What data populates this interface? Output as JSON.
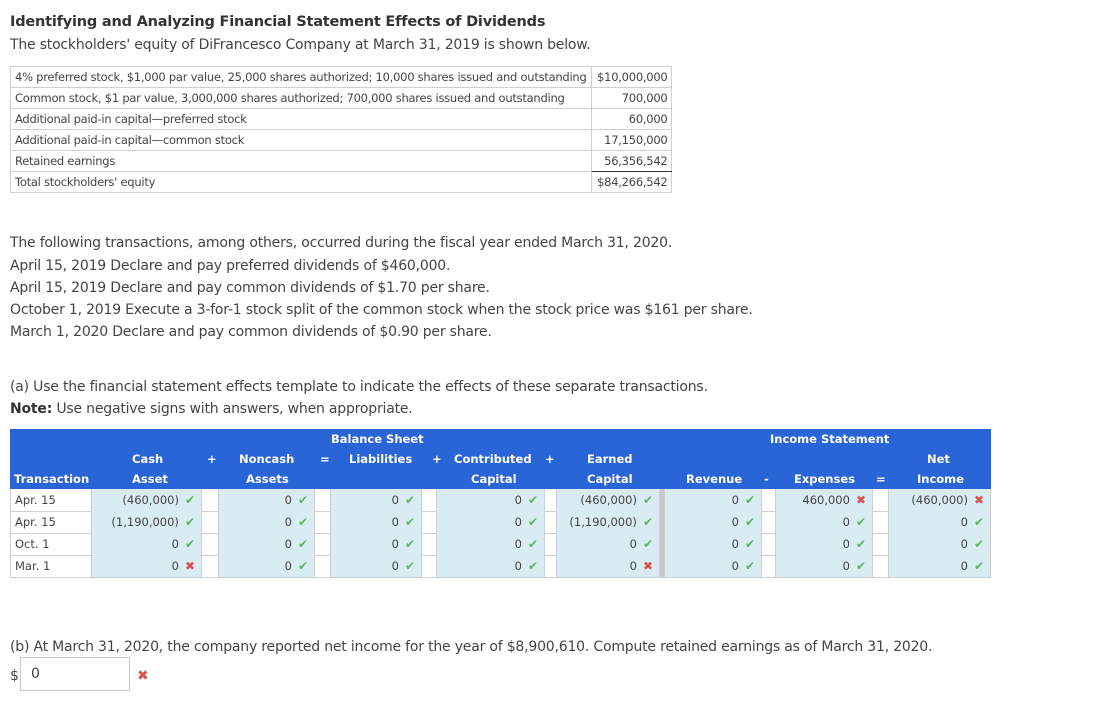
{
  "title": "Identifying and Analyzing Financial Statement Effects of Dividends",
  "subtitle": "The stockholders' equity of DiFrancesco Company at March 31, 2019 is shown below.",
  "equity_table": [
    {
      "label": "4% preferred stock, $1,000 par value, 25,000 shares authorized; 10,000 shares issued and outstanding",
      "amount": "$10,000,000"
    },
    {
      "label": "Common stock, $1 par value, 3,000,000 shares authorized; 700,000 shares issued and outstanding",
      "amount": "700,000"
    },
    {
      "label": "Additional paid-in capital—preferred stock",
      "amount": "60,000"
    },
    {
      "label": "Additional paid-in capital—common stock",
      "amount": "17,150,000"
    },
    {
      "label": "Retained earnings",
      "amount": "56,356,542"
    },
    {
      "label": "Total stockholders' equity",
      "amount": "$84,266,542"
    }
  ],
  "transactions_intro": "The following transactions, among others, occurred during the fiscal year ended March 31, 2020.",
  "transactions": [
    "April 15, 2019 Declare and pay preferred dividends of $460,000.",
    "April 15, 2019 Declare and pay common dividends of $1.70 per share.",
    "October 1, 2019 Execute a 3-for-1 stock split of the common stock when the stock price was $161 per share.",
    "March 1, 2020 Declare and pay common dividends of $0.90 per share."
  ],
  "part_a": {
    "instruction": "(a) Use the financial statement effects template to indicate the effects of these separate transactions.",
    "note_label": "Note:",
    "note_text": " Use negative signs with answers, when appropriate."
  },
  "effects_table": {
    "group_balance_sheet": "Balance Sheet",
    "group_income_statement": "Income Statement",
    "headers": {
      "transaction": "Transaction",
      "cash_1": "Cash",
      "cash_2": "Asset",
      "noncash_1": "Noncash",
      "noncash_2": "Assets",
      "liabilities": "Liabilities",
      "contributed_1": "Contributed",
      "contributed_2": "Capital",
      "earned_1": "Earned",
      "earned_2": "Capital",
      "revenue": "Revenue",
      "expenses": "Expenses",
      "net_1": "Net",
      "net_2": "Income"
    },
    "operators": {
      "plus": "+",
      "equals": "=",
      "minus": "-"
    },
    "rows": [
      {
        "transaction": "Apr. 15",
        "cash": {
          "value": "(460,000)",
          "status": "correct"
        },
        "noncash": {
          "value": "0",
          "status": "correct"
        },
        "liabilities": {
          "value": "0",
          "status": "correct"
        },
        "contributed": {
          "value": "0",
          "status": "correct"
        },
        "earned": {
          "value": "(460,000)",
          "status": "correct"
        },
        "revenue": {
          "value": "0",
          "status": "correct"
        },
        "expenses": {
          "value": "460,000",
          "status": "incorrect"
        },
        "net_income": {
          "value": "(460,000)",
          "status": "incorrect"
        }
      },
      {
        "transaction": "Apr. 15",
        "cash": {
          "value": "(1,190,000)",
          "status": "correct"
        },
        "noncash": {
          "value": "0",
          "status": "correct"
        },
        "liabilities": {
          "value": "0",
          "status": "correct"
        },
        "contributed": {
          "value": "0",
          "status": "correct"
        },
        "earned": {
          "value": "(1,190,000)",
          "status": "correct"
        },
        "revenue": {
          "value": "0",
          "status": "correct"
        },
        "expenses": {
          "value": "0",
          "status": "correct"
        },
        "net_income": {
          "value": "0",
          "status": "correct"
        }
      },
      {
        "transaction": "Oct. 1",
        "cash": {
          "value": "0",
          "status": "correct"
        },
        "noncash": {
          "value": "0",
          "status": "correct"
        },
        "liabilities": {
          "value": "0",
          "status": "correct"
        },
        "contributed": {
          "value": "0",
          "status": "correct"
        },
        "earned": {
          "value": "0",
          "status": "correct"
        },
        "revenue": {
          "value": "0",
          "status": "correct"
        },
        "expenses": {
          "value": "0",
          "status": "correct"
        },
        "net_income": {
          "value": "0",
          "status": "correct"
        }
      },
      {
        "transaction": "Mar. 1",
        "cash": {
          "value": "0",
          "status": "incorrect"
        },
        "noncash": {
          "value": "0",
          "status": "correct"
        },
        "liabilities": {
          "value": "0",
          "status": "correct"
        },
        "contributed": {
          "value": "0",
          "status": "correct"
        },
        "earned": {
          "value": "0",
          "status": "incorrect"
        },
        "revenue": {
          "value": "0",
          "status": "correct"
        },
        "expenses": {
          "value": "0",
          "status": "correct"
        },
        "net_income": {
          "value": "0",
          "status": "correct"
        }
      }
    ]
  },
  "part_b": {
    "question": "(b) At March 31, 2020, the company reported net income for the year of $8,900,610. Compute retained earnings as of March 31, 2020.",
    "currency": "$",
    "answer_value": "0",
    "answer_status": "incorrect"
  },
  "marks": {
    "correct": "✔",
    "incorrect": "✖"
  },
  "colors": {
    "header_bg": "#2965d6",
    "input_bg": "#d9ebf3",
    "correct": "#5cb85c",
    "incorrect": "#d9534f"
  }
}
